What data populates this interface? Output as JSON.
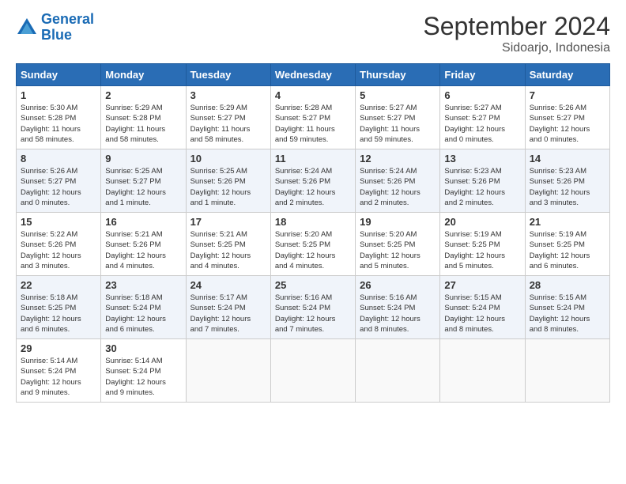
{
  "header": {
    "logo_line1": "General",
    "logo_line2": "Blue",
    "month": "September 2024",
    "location": "Sidoarjo, Indonesia"
  },
  "days_of_week": [
    "Sunday",
    "Monday",
    "Tuesday",
    "Wednesday",
    "Thursday",
    "Friday",
    "Saturday"
  ],
  "weeks": [
    [
      {
        "day": 1,
        "info": "Sunrise: 5:30 AM\nSunset: 5:28 PM\nDaylight: 11 hours\nand 58 minutes."
      },
      {
        "day": 2,
        "info": "Sunrise: 5:29 AM\nSunset: 5:28 PM\nDaylight: 11 hours\nand 58 minutes."
      },
      {
        "day": 3,
        "info": "Sunrise: 5:29 AM\nSunset: 5:27 PM\nDaylight: 11 hours\nand 58 minutes."
      },
      {
        "day": 4,
        "info": "Sunrise: 5:28 AM\nSunset: 5:27 PM\nDaylight: 11 hours\nand 59 minutes."
      },
      {
        "day": 5,
        "info": "Sunrise: 5:27 AM\nSunset: 5:27 PM\nDaylight: 11 hours\nand 59 minutes."
      },
      {
        "day": 6,
        "info": "Sunrise: 5:27 AM\nSunset: 5:27 PM\nDaylight: 12 hours\nand 0 minutes."
      },
      {
        "day": 7,
        "info": "Sunrise: 5:26 AM\nSunset: 5:27 PM\nDaylight: 12 hours\nand 0 minutes."
      }
    ],
    [
      {
        "day": 8,
        "info": "Sunrise: 5:26 AM\nSunset: 5:27 PM\nDaylight: 12 hours\nand 0 minutes."
      },
      {
        "day": 9,
        "info": "Sunrise: 5:25 AM\nSunset: 5:27 PM\nDaylight: 12 hours\nand 1 minute."
      },
      {
        "day": 10,
        "info": "Sunrise: 5:25 AM\nSunset: 5:26 PM\nDaylight: 12 hours\nand 1 minute."
      },
      {
        "day": 11,
        "info": "Sunrise: 5:24 AM\nSunset: 5:26 PM\nDaylight: 12 hours\nand 2 minutes."
      },
      {
        "day": 12,
        "info": "Sunrise: 5:24 AM\nSunset: 5:26 PM\nDaylight: 12 hours\nand 2 minutes."
      },
      {
        "day": 13,
        "info": "Sunrise: 5:23 AM\nSunset: 5:26 PM\nDaylight: 12 hours\nand 2 minutes."
      },
      {
        "day": 14,
        "info": "Sunrise: 5:23 AM\nSunset: 5:26 PM\nDaylight: 12 hours\nand 3 minutes."
      }
    ],
    [
      {
        "day": 15,
        "info": "Sunrise: 5:22 AM\nSunset: 5:26 PM\nDaylight: 12 hours\nand 3 minutes."
      },
      {
        "day": 16,
        "info": "Sunrise: 5:21 AM\nSunset: 5:26 PM\nDaylight: 12 hours\nand 4 minutes."
      },
      {
        "day": 17,
        "info": "Sunrise: 5:21 AM\nSunset: 5:25 PM\nDaylight: 12 hours\nand 4 minutes."
      },
      {
        "day": 18,
        "info": "Sunrise: 5:20 AM\nSunset: 5:25 PM\nDaylight: 12 hours\nand 4 minutes."
      },
      {
        "day": 19,
        "info": "Sunrise: 5:20 AM\nSunset: 5:25 PM\nDaylight: 12 hours\nand 5 minutes."
      },
      {
        "day": 20,
        "info": "Sunrise: 5:19 AM\nSunset: 5:25 PM\nDaylight: 12 hours\nand 5 minutes."
      },
      {
        "day": 21,
        "info": "Sunrise: 5:19 AM\nSunset: 5:25 PM\nDaylight: 12 hours\nand 6 minutes."
      }
    ],
    [
      {
        "day": 22,
        "info": "Sunrise: 5:18 AM\nSunset: 5:25 PM\nDaylight: 12 hours\nand 6 minutes."
      },
      {
        "day": 23,
        "info": "Sunrise: 5:18 AM\nSunset: 5:24 PM\nDaylight: 12 hours\nand 6 minutes."
      },
      {
        "day": 24,
        "info": "Sunrise: 5:17 AM\nSunset: 5:24 PM\nDaylight: 12 hours\nand 7 minutes."
      },
      {
        "day": 25,
        "info": "Sunrise: 5:16 AM\nSunset: 5:24 PM\nDaylight: 12 hours\nand 7 minutes."
      },
      {
        "day": 26,
        "info": "Sunrise: 5:16 AM\nSunset: 5:24 PM\nDaylight: 12 hours\nand 8 minutes."
      },
      {
        "day": 27,
        "info": "Sunrise: 5:15 AM\nSunset: 5:24 PM\nDaylight: 12 hours\nand 8 minutes."
      },
      {
        "day": 28,
        "info": "Sunrise: 5:15 AM\nSunset: 5:24 PM\nDaylight: 12 hours\nand 8 minutes."
      }
    ],
    [
      {
        "day": 29,
        "info": "Sunrise: 5:14 AM\nSunset: 5:24 PM\nDaylight: 12 hours\nand 9 minutes."
      },
      {
        "day": 30,
        "info": "Sunrise: 5:14 AM\nSunset: 5:24 PM\nDaylight: 12 hours\nand 9 minutes."
      },
      null,
      null,
      null,
      null,
      null
    ]
  ]
}
